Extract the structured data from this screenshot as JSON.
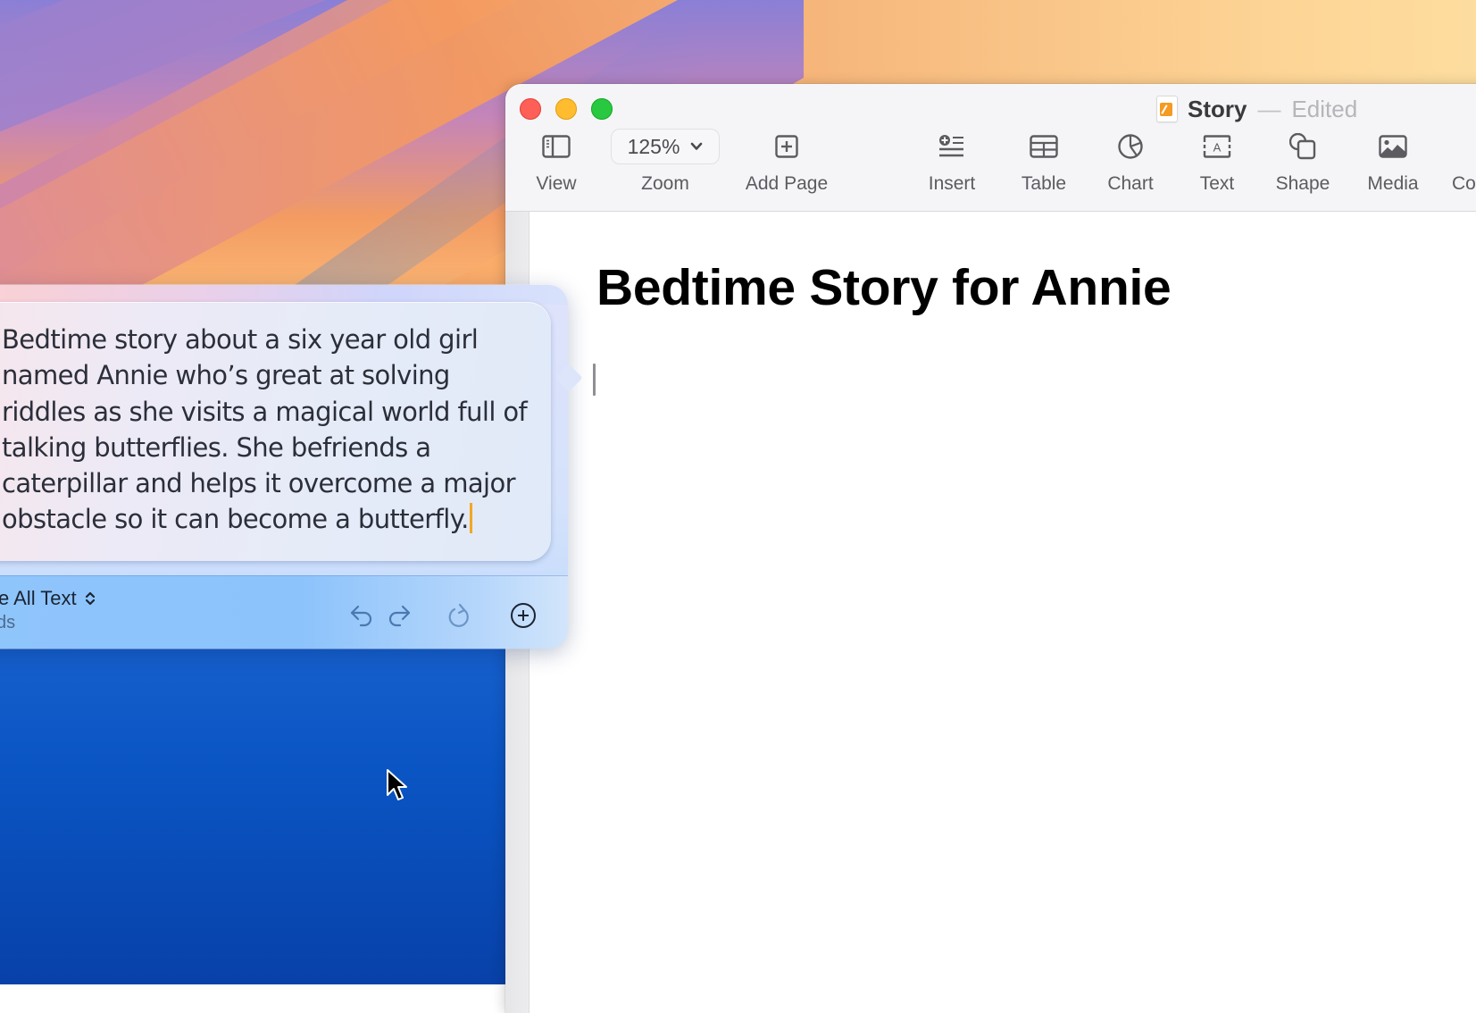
{
  "window": {
    "app": "Pages",
    "title": "Story",
    "title_separator": "—",
    "status": "Edited",
    "traffic_lights": [
      "close",
      "minimize",
      "zoom"
    ],
    "colors": {
      "close": "#fe5f57",
      "minimize": "#febc2e",
      "zoom": "#28c840"
    }
  },
  "toolbar": {
    "view": {
      "label": "View",
      "icon": "sidebar-icon"
    },
    "zoom": {
      "label": "Zoom",
      "value": "125%",
      "icon": "chevron-down-icon"
    },
    "add_page": {
      "label": "Add Page",
      "icon": "plus-square-icon"
    },
    "insert": {
      "label": "Insert",
      "icon": "insert-list-icon"
    },
    "table": {
      "label": "Table",
      "icon": "table-icon"
    },
    "chart": {
      "label": "Chart",
      "icon": "pie-chart-icon"
    },
    "text": {
      "label": "Text",
      "icon": "text-box-icon"
    },
    "shape": {
      "label": "Shape",
      "icon": "shape-icon"
    },
    "media": {
      "label": "Media",
      "icon": "image-icon"
    },
    "comment": {
      "label": "Co",
      "icon": "comment-icon"
    }
  },
  "document": {
    "heading": "Bedtime Story for Annie",
    "body": ""
  },
  "writing_tools": {
    "prompt": "Bedtime story about a six year old girl named Annie who’s great at solving riddles as she visits a magical world full of talking butterflies. She befriends a caterpillar and helps it overcome a major obstacle so it can become a butterfly.",
    "mode_label": "e All Text",
    "mode_sub": "ds",
    "caret_color": "#f5a623",
    "buttons": [
      "undo",
      "redo",
      "regenerate",
      "add"
    ]
  }
}
